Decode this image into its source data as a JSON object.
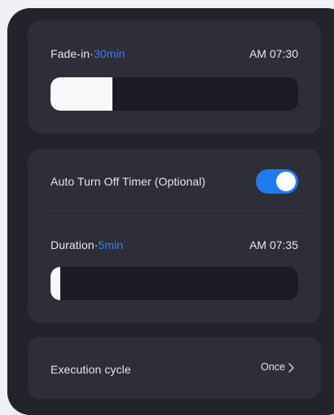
{
  "fade_in": {
    "label": "Fade-in·",
    "value": "30min",
    "time": "AM 07:30",
    "progress": 0.25
  },
  "auto_off": {
    "label": "Auto Turn Off Timer (Optional)",
    "enabled": true
  },
  "duration": {
    "label": "Duration·",
    "value": "5min",
    "time": "AM 07:35",
    "progress": 0.04
  },
  "execution": {
    "label": "Execution cycle",
    "value": "Once"
  },
  "colors": {
    "accent": "#2f80ff",
    "toggle_on": "#1e7cf2",
    "card": "#2e2e38",
    "background": "#23232b"
  },
  "icons": {
    "chevron": "chevron-right-icon"
  }
}
